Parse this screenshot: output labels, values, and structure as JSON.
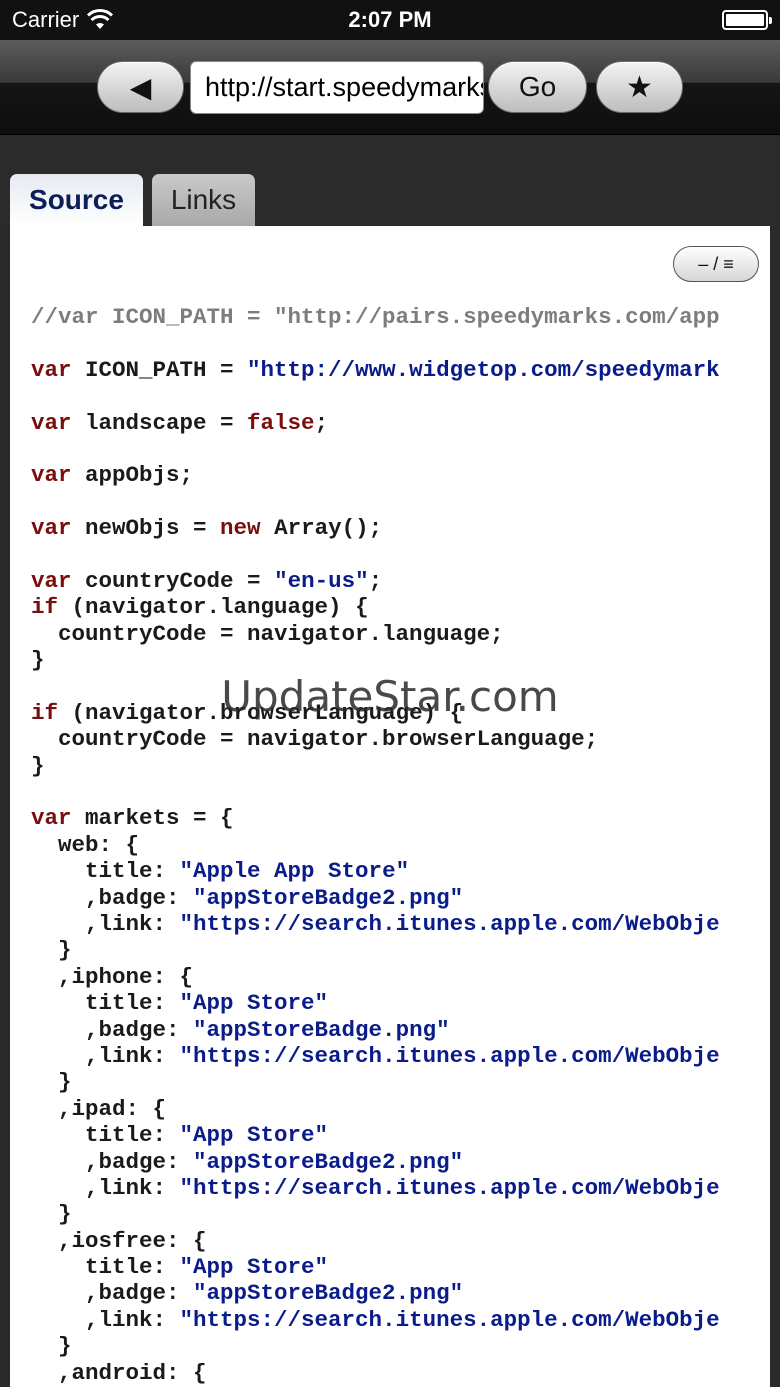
{
  "status_bar": {
    "carrier": "Carrier",
    "time": "2:07 PM"
  },
  "toolbar": {
    "back_icon": "◀",
    "url_value": "http://start.speedymarks.com/",
    "go_label": "Go",
    "bookmark_icon": "★"
  },
  "tabs": [
    {
      "label": "Source",
      "selected": true
    },
    {
      "label": "Links",
      "selected": false
    }
  ],
  "toggle_label": "– / ≡",
  "watermark": "UpdateStar.com",
  "colors": {
    "keyword": "#7a0d0d",
    "string": "#0a1b8a",
    "comment": "#7d7d7d"
  },
  "code_lines": [
    [
      [
        "cmt",
        "//var ICON_PATH = \"http://pairs.speedymarks.com/app"
      ]
    ],
    [],
    [
      [
        "kw",
        "var"
      ],
      [
        "",
        " ICON_PATH = "
      ],
      [
        "str",
        "\"http://www.widgetop.com/speedymark"
      ]
    ],
    [],
    [
      [
        "kw",
        "var"
      ],
      [
        "",
        " landscape = "
      ],
      [
        "kw",
        "false"
      ],
      [
        "",
        ";"
      ]
    ],
    [],
    [
      [
        "kw",
        "var"
      ],
      [
        "",
        " appObjs;"
      ]
    ],
    [],
    [
      [
        "kw",
        "var"
      ],
      [
        "",
        " newObjs = "
      ],
      [
        "kw",
        "new"
      ],
      [
        "",
        " Array();"
      ]
    ],
    [],
    [
      [
        "kw",
        "var"
      ],
      [
        "",
        " countryCode = "
      ],
      [
        "str",
        "\"en-us\""
      ],
      [
        "",
        ";"
      ]
    ],
    [
      [
        "kw",
        "if"
      ],
      [
        "",
        " (navigator.language) {"
      ]
    ],
    [
      [
        "",
        "  countryCode = navigator.language;"
      ]
    ],
    [
      [
        "",
        "}"
      ]
    ],
    [],
    [
      [
        "kw",
        "if"
      ],
      [
        "",
        " (navigator.browserLanguage) {"
      ]
    ],
    [
      [
        "",
        "  countryCode = navigator.browserLanguage;"
      ]
    ],
    [
      [
        "",
        "}"
      ]
    ],
    [],
    [
      [
        "kw",
        "var"
      ],
      [
        "",
        " markets = {"
      ]
    ],
    [
      [
        "",
        "  web: {"
      ]
    ],
    [
      [
        "",
        "    title: "
      ],
      [
        "str",
        "\"Apple App Store\""
      ]
    ],
    [
      [
        "",
        "    ,badge: "
      ],
      [
        "str",
        "\"appStoreBadge2.png\""
      ]
    ],
    [
      [
        "",
        "    ,link: "
      ],
      [
        "str",
        "\"https://search.itunes.apple.com/WebObje"
      ]
    ],
    [
      [
        "",
        "  }"
      ]
    ],
    [
      [
        "",
        "  ,iphone: {"
      ]
    ],
    [
      [
        "",
        "    title: "
      ],
      [
        "str",
        "\"App Store\""
      ]
    ],
    [
      [
        "",
        "    ,badge: "
      ],
      [
        "str",
        "\"appStoreBadge.png\""
      ]
    ],
    [
      [
        "",
        "    ,link: "
      ],
      [
        "str",
        "\"https://search.itunes.apple.com/WebObje"
      ]
    ],
    [
      [
        "",
        "  }"
      ]
    ],
    [
      [
        "",
        "  ,ipad: {"
      ]
    ],
    [
      [
        "",
        "    title: "
      ],
      [
        "str",
        "\"App Store\""
      ]
    ],
    [
      [
        "",
        "    ,badge: "
      ],
      [
        "str",
        "\"appStoreBadge2.png\""
      ]
    ],
    [
      [
        "",
        "    ,link: "
      ],
      [
        "str",
        "\"https://search.itunes.apple.com/WebObje"
      ]
    ],
    [
      [
        "",
        "  }"
      ]
    ],
    [
      [
        "",
        "  ,iosfree: {"
      ]
    ],
    [
      [
        "",
        "    title: "
      ],
      [
        "str",
        "\"App Store\""
      ]
    ],
    [
      [
        "",
        "    ,badge: "
      ],
      [
        "str",
        "\"appStoreBadge2.png\""
      ]
    ],
    [
      [
        "",
        "    ,link: "
      ],
      [
        "str",
        "\"https://search.itunes.apple.com/WebObje"
      ]
    ],
    [
      [
        "",
        "  }"
      ]
    ],
    [
      [
        "",
        "  ,android: {"
      ]
    ]
  ]
}
